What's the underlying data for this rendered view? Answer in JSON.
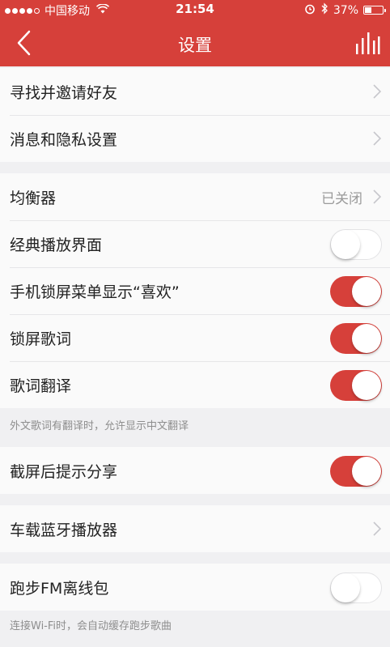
{
  "status_bar": {
    "carrier": "中国移动",
    "time": "21:54",
    "battery_percent": "37%",
    "battery_level": 0.37
  },
  "nav": {
    "title": "设置"
  },
  "section1": {
    "items": [
      {
        "label": "寻找并邀请好友"
      },
      {
        "label": "消息和隐私设置"
      }
    ]
  },
  "section2": {
    "items": [
      {
        "label": "均衡器",
        "value": "已关闭"
      },
      {
        "label": "经典播放界面",
        "toggle": false
      },
      {
        "label": "手机锁屏菜单显示“喜欢”",
        "toggle": true
      },
      {
        "label": "锁屏歌词",
        "toggle": true
      },
      {
        "label": "歌词翻译",
        "toggle": true
      }
    ],
    "note": "外文歌词有翻译时，允许显示中文翻译"
  },
  "section3": {
    "items": [
      {
        "label": "截屏后提示分享",
        "toggle": true
      }
    ]
  },
  "section4": {
    "items": [
      {
        "label": "车载蓝牙播放器"
      }
    ]
  },
  "section5": {
    "items": [
      {
        "label": "跑步FM离线包",
        "toggle": false
      }
    ],
    "note": "连接Wi-Fi时，会自动缓存跑步歌曲"
  },
  "colors": {
    "accent": "#d6403a",
    "background": "#f0f0f2",
    "row_background": "#fafafa"
  },
  "icons": [
    "back-arrow-icon",
    "equalizer-bars-icon",
    "chevron-right-icon",
    "wifi-icon",
    "alarm-icon",
    "bluetooth-icon",
    "battery-icon"
  ]
}
